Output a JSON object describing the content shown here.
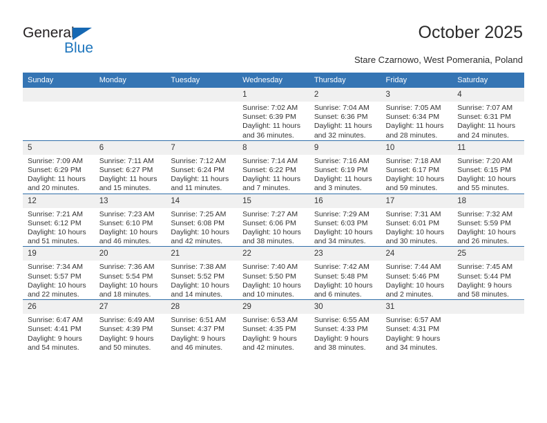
{
  "brand": {
    "name_part1": "General",
    "name_part2": "Blue",
    "accent_color": "#1d75bd",
    "triangle_color": "#1668b3"
  },
  "header": {
    "title": "October 2025",
    "subtitle": "Stare Czarnowo, West Pomerania, Poland"
  },
  "calendar": {
    "header_bg": "#3575b4",
    "row_divider": "#2e6da8",
    "daynum_bg": "#f0f0f0",
    "weekdays": [
      "Sunday",
      "Monday",
      "Tuesday",
      "Wednesday",
      "Thursday",
      "Friday",
      "Saturday"
    ],
    "weeks": [
      [
        {
          "day": "",
          "lines": []
        },
        {
          "day": "",
          "lines": []
        },
        {
          "day": "",
          "lines": []
        },
        {
          "day": "1",
          "lines": [
            "Sunrise: 7:02 AM",
            "Sunset: 6:39 PM",
            "Daylight: 11 hours",
            "and 36 minutes."
          ]
        },
        {
          "day": "2",
          "lines": [
            "Sunrise: 7:04 AM",
            "Sunset: 6:36 PM",
            "Daylight: 11 hours",
            "and 32 minutes."
          ]
        },
        {
          "day": "3",
          "lines": [
            "Sunrise: 7:05 AM",
            "Sunset: 6:34 PM",
            "Daylight: 11 hours",
            "and 28 minutes."
          ]
        },
        {
          "day": "4",
          "lines": [
            "Sunrise: 7:07 AM",
            "Sunset: 6:31 PM",
            "Daylight: 11 hours",
            "and 24 minutes."
          ]
        }
      ],
      [
        {
          "day": "5",
          "lines": [
            "Sunrise: 7:09 AM",
            "Sunset: 6:29 PM",
            "Daylight: 11 hours",
            "and 20 minutes."
          ]
        },
        {
          "day": "6",
          "lines": [
            "Sunrise: 7:11 AM",
            "Sunset: 6:27 PM",
            "Daylight: 11 hours",
            "and 15 minutes."
          ]
        },
        {
          "day": "7",
          "lines": [
            "Sunrise: 7:12 AM",
            "Sunset: 6:24 PM",
            "Daylight: 11 hours",
            "and 11 minutes."
          ]
        },
        {
          "day": "8",
          "lines": [
            "Sunrise: 7:14 AM",
            "Sunset: 6:22 PM",
            "Daylight: 11 hours",
            "and 7 minutes."
          ]
        },
        {
          "day": "9",
          "lines": [
            "Sunrise: 7:16 AM",
            "Sunset: 6:19 PM",
            "Daylight: 11 hours",
            "and 3 minutes."
          ]
        },
        {
          "day": "10",
          "lines": [
            "Sunrise: 7:18 AM",
            "Sunset: 6:17 PM",
            "Daylight: 10 hours",
            "and 59 minutes."
          ]
        },
        {
          "day": "11",
          "lines": [
            "Sunrise: 7:20 AM",
            "Sunset: 6:15 PM",
            "Daylight: 10 hours",
            "and 55 minutes."
          ]
        }
      ],
      [
        {
          "day": "12",
          "lines": [
            "Sunrise: 7:21 AM",
            "Sunset: 6:12 PM",
            "Daylight: 10 hours",
            "and 51 minutes."
          ]
        },
        {
          "day": "13",
          "lines": [
            "Sunrise: 7:23 AM",
            "Sunset: 6:10 PM",
            "Daylight: 10 hours",
            "and 46 minutes."
          ]
        },
        {
          "day": "14",
          "lines": [
            "Sunrise: 7:25 AM",
            "Sunset: 6:08 PM",
            "Daylight: 10 hours",
            "and 42 minutes."
          ]
        },
        {
          "day": "15",
          "lines": [
            "Sunrise: 7:27 AM",
            "Sunset: 6:06 PM",
            "Daylight: 10 hours",
            "and 38 minutes."
          ]
        },
        {
          "day": "16",
          "lines": [
            "Sunrise: 7:29 AM",
            "Sunset: 6:03 PM",
            "Daylight: 10 hours",
            "and 34 minutes."
          ]
        },
        {
          "day": "17",
          "lines": [
            "Sunrise: 7:31 AM",
            "Sunset: 6:01 PM",
            "Daylight: 10 hours",
            "and 30 minutes."
          ]
        },
        {
          "day": "18",
          "lines": [
            "Sunrise: 7:32 AM",
            "Sunset: 5:59 PM",
            "Daylight: 10 hours",
            "and 26 minutes."
          ]
        }
      ],
      [
        {
          "day": "19",
          "lines": [
            "Sunrise: 7:34 AM",
            "Sunset: 5:57 PM",
            "Daylight: 10 hours",
            "and 22 minutes."
          ]
        },
        {
          "day": "20",
          "lines": [
            "Sunrise: 7:36 AM",
            "Sunset: 5:54 PM",
            "Daylight: 10 hours",
            "and 18 minutes."
          ]
        },
        {
          "day": "21",
          "lines": [
            "Sunrise: 7:38 AM",
            "Sunset: 5:52 PM",
            "Daylight: 10 hours",
            "and 14 minutes."
          ]
        },
        {
          "day": "22",
          "lines": [
            "Sunrise: 7:40 AM",
            "Sunset: 5:50 PM",
            "Daylight: 10 hours",
            "and 10 minutes."
          ]
        },
        {
          "day": "23",
          "lines": [
            "Sunrise: 7:42 AM",
            "Sunset: 5:48 PM",
            "Daylight: 10 hours",
            "and 6 minutes."
          ]
        },
        {
          "day": "24",
          "lines": [
            "Sunrise: 7:44 AM",
            "Sunset: 5:46 PM",
            "Daylight: 10 hours",
            "and 2 minutes."
          ]
        },
        {
          "day": "25",
          "lines": [
            "Sunrise: 7:45 AM",
            "Sunset: 5:44 PM",
            "Daylight: 9 hours",
            "and 58 minutes."
          ]
        }
      ],
      [
        {
          "day": "26",
          "lines": [
            "Sunrise: 6:47 AM",
            "Sunset: 4:41 PM",
            "Daylight: 9 hours",
            "and 54 minutes."
          ]
        },
        {
          "day": "27",
          "lines": [
            "Sunrise: 6:49 AM",
            "Sunset: 4:39 PM",
            "Daylight: 9 hours",
            "and 50 minutes."
          ]
        },
        {
          "day": "28",
          "lines": [
            "Sunrise: 6:51 AM",
            "Sunset: 4:37 PM",
            "Daylight: 9 hours",
            "and 46 minutes."
          ]
        },
        {
          "day": "29",
          "lines": [
            "Sunrise: 6:53 AM",
            "Sunset: 4:35 PM",
            "Daylight: 9 hours",
            "and 42 minutes."
          ]
        },
        {
          "day": "30",
          "lines": [
            "Sunrise: 6:55 AM",
            "Sunset: 4:33 PM",
            "Daylight: 9 hours",
            "and 38 minutes."
          ]
        },
        {
          "day": "31",
          "lines": [
            "Sunrise: 6:57 AM",
            "Sunset: 4:31 PM",
            "Daylight: 9 hours",
            "and 34 minutes."
          ]
        },
        {
          "day": "",
          "lines": []
        }
      ]
    ]
  }
}
